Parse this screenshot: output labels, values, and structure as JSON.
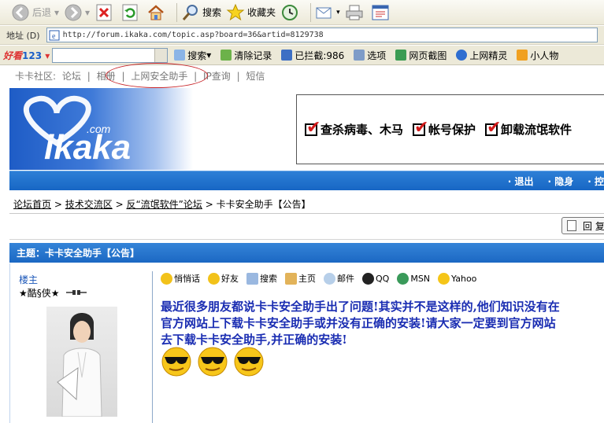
{
  "toolbar": {
    "back": "后退",
    "search": "搜索",
    "favorites": "收藏夹"
  },
  "address": {
    "label": "地址 (D)",
    "url": "http://forum.ikaka.com/topic.asp?board=36&artid=8129738"
  },
  "ybar": {
    "brand": "好看",
    "brand_num": "123",
    "search": "搜索",
    "clear": "清除记录",
    "blocked": "已拦截:986",
    "options": "选项",
    "screenshot": "网页截图",
    "spirit": "上网精灵",
    "xiaoren": "小人物"
  },
  "topnav": {
    "items": [
      "卡卡社区:",
      "论坛",
      "相册",
      "上网安全助手",
      "IP查询",
      "短信"
    ],
    "sep": "|"
  },
  "banner": {
    "logo_com": ".com",
    "logo_text": "ikaka",
    "promo": [
      "查杀病毒、木马",
      "帐号保护",
      "卸载流氓软件"
    ]
  },
  "bluebar": [
    "· 退出",
    "· 隐身",
    "· 控"
  ],
  "breadcrumb": {
    "items": [
      "论坛首页",
      "技术交流区",
      "反“流氓软件”论坛"
    ],
    "current": "卡卡安全助手【公告】",
    "sep": ">"
  },
  "reply_label": "回 复",
  "subject": "主题：卡卡安全助手【公告】",
  "author": {
    "role": "楼主",
    "name": "★酷§侠★"
  },
  "actions": [
    "悄悄话",
    "好友",
    "搜索",
    "主页",
    "邮件",
    "QQ",
    "MSN",
    "Yahoo"
  ],
  "post_lines": [
    "最近很多朋友都说卡卡安全助手出了问题!其实并不是这样的,他们知识没有在",
    "官方网站上下载卡卡安全助手或并没有正确的安装!请大家一定要到官方网站",
    "去下载卡卡安全助手,并正确的安装!"
  ],
  "colors": {
    "link_blue": "#1a56b8",
    "post_text": "#1a2db2",
    "header_blue": "#1b68c3",
    "highlight_circle": "#c8252a"
  }
}
